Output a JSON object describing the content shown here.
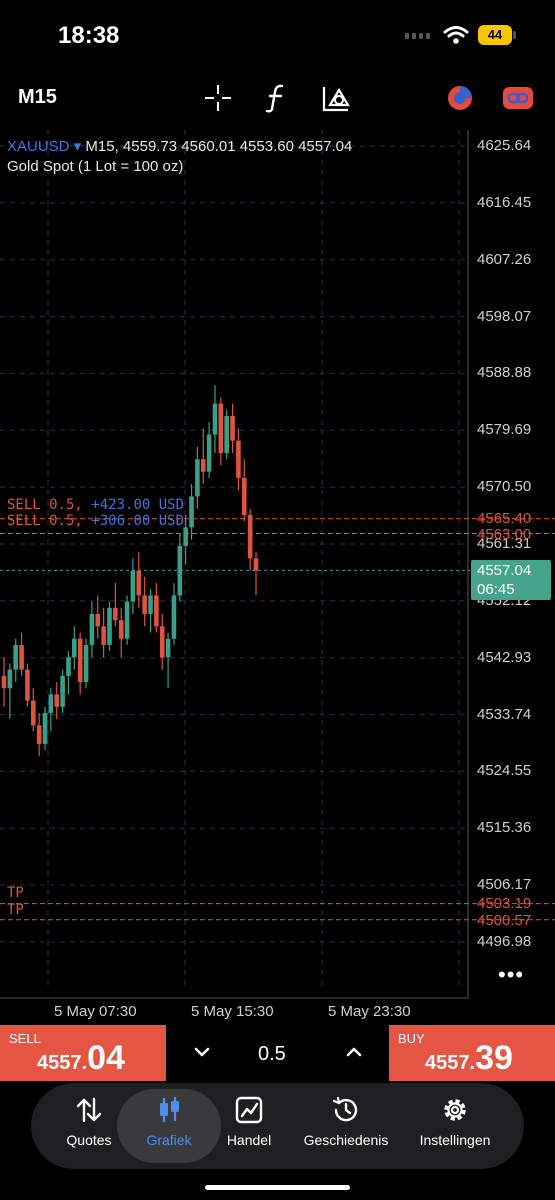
{
  "status_bar": {
    "time": "18:38",
    "battery": "44"
  },
  "toolbar": {
    "timeframe": "M15"
  },
  "chart_header": {
    "symbol": "XAUUSD",
    "timeframe": "M15",
    "ohlc": "4559.73 4560.01 4553.60 4557.04",
    "description": "Gold Spot (1 Lot = 100 oz)"
  },
  "colors": {
    "bull": "#3a9f88",
    "bear": "#e0533d",
    "accent": "#3f74e0",
    "current": "#44a48c"
  },
  "positions": [
    {
      "side": "SELL 0.5,",
      "pnl": "+423.00 USD",
      "price": "4565.40"
    },
    {
      "side": "SELL 0.5,",
      "pnl": "+306.00 USD",
      "price": "4563.00"
    }
  ],
  "take_profits": [
    {
      "label": "TP",
      "price": "4503.19"
    },
    {
      "label": "TP",
      "price": "4500.57"
    }
  ],
  "current": {
    "price": "4557.04",
    "countdown": "06:45"
  },
  "chart_data": {
    "type": "candlestick",
    "price_axis_ticks": [
      "4625.64",
      "4616.45",
      "4607.26",
      "4598.07",
      "4588.88",
      "4579.69",
      "4570.50",
      "4561.31",
      "4552.12",
      "4542.93",
      "4533.74",
      "4524.55",
      "4515.36",
      "4506.17",
      "4496.98"
    ],
    "time_axis_labels": [
      "5 May 07:30",
      "5 May 15:30",
      "5 May 23:30"
    ],
    "ylim": [
      4496.98,
      4625.64
    ],
    "grid": true,
    "candles": [
      [
        4540,
        4543,
        4535,
        4538
      ],
      [
        4538,
        4542,
        4533,
        4541
      ],
      [
        4541,
        4546,
        4539,
        4545
      ],
      [
        4545,
        4547,
        4540,
        4541
      ],
      [
        4541,
        4542,
        4535,
        4536
      ],
      [
        4536,
        4538,
        4531,
        4532
      ],
      [
        4532,
        4534,
        4527,
        4529
      ],
      [
        4529,
        4535,
        4528,
        4534
      ],
      [
        4534,
        4538,
        4531,
        4537
      ],
      [
        4537,
        4539,
        4533,
        4535
      ],
      [
        4535,
        4541,
        4534,
        4540
      ],
      [
        4540,
        4544,
        4537,
        4543
      ],
      [
        4543,
        4548,
        4541,
        4546
      ],
      [
        4546,
        4547,
        4537,
        4539
      ],
      [
        4539,
        4546,
        4538,
        4545
      ],
      [
        4545,
        4552,
        4543,
        4550
      ],
      [
        4550,
        4553,
        4546,
        4548
      ],
      [
        4548,
        4551,
        4543,
        4545
      ],
      [
        4545,
        4552,
        4544,
        4551
      ],
      [
        4551,
        4555,
        4548,
        4549
      ],
      [
        4549,
        4551,
        4543,
        4546
      ],
      [
        4546,
        4553,
        4545,
        4552
      ],
      [
        4552,
        4559,
        4550,
        4557
      ],
      [
        4557,
        4560,
        4551,
        4553
      ],
      [
        4553,
        4556,
        4548,
        4550
      ],
      [
        4550,
        4554,
        4547,
        4553
      ],
      [
        4553,
        4555,
        4547,
        4548
      ],
      [
        4548,
        4550,
        4541,
        4543
      ],
      [
        4543,
        4547,
        4538,
        4546
      ],
      [
        4546,
        4555,
        4545,
        4553
      ],
      [
        4553,
        4563,
        4552,
        4561
      ],
      [
        4561,
        4566,
        4558,
        4564
      ],
      [
        4564,
        4571,
        4562,
        4569
      ],
      [
        4569,
        4577,
        4567,
        4575
      ],
      [
        4575,
        4580,
        4571,
        4573
      ],
      [
        4573,
        4581,
        4572,
        4579
      ],
      [
        4579,
        4587,
        4576,
        4584
      ],
      [
        4584,
        4585,
        4574,
        4576
      ],
      [
        4576,
        4583,
        4575,
        4582
      ],
      [
        4582,
        4584,
        4576,
        4578
      ],
      [
        4578,
        4580,
        4570,
        4572
      ],
      [
        4572,
        4575,
        4565,
        4566
      ],
      [
        4566,
        4567,
        4557,
        4559
      ],
      [
        4559,
        4560,
        4553,
        4557
      ]
    ]
  },
  "trade_bar": {
    "sell_label": "SELL",
    "sell_price_small": "4557.",
    "sell_price_big": "04",
    "buy_label": "BUY",
    "buy_price_small": "4557.",
    "buy_price_big": "39",
    "lot_size": "0.5"
  },
  "nav": {
    "items": [
      {
        "label": "Quotes"
      },
      {
        "label": "Grafiek"
      },
      {
        "label": "Handel"
      },
      {
        "label": "Geschiedenis"
      },
      {
        "label": "Instellingen"
      }
    ]
  }
}
